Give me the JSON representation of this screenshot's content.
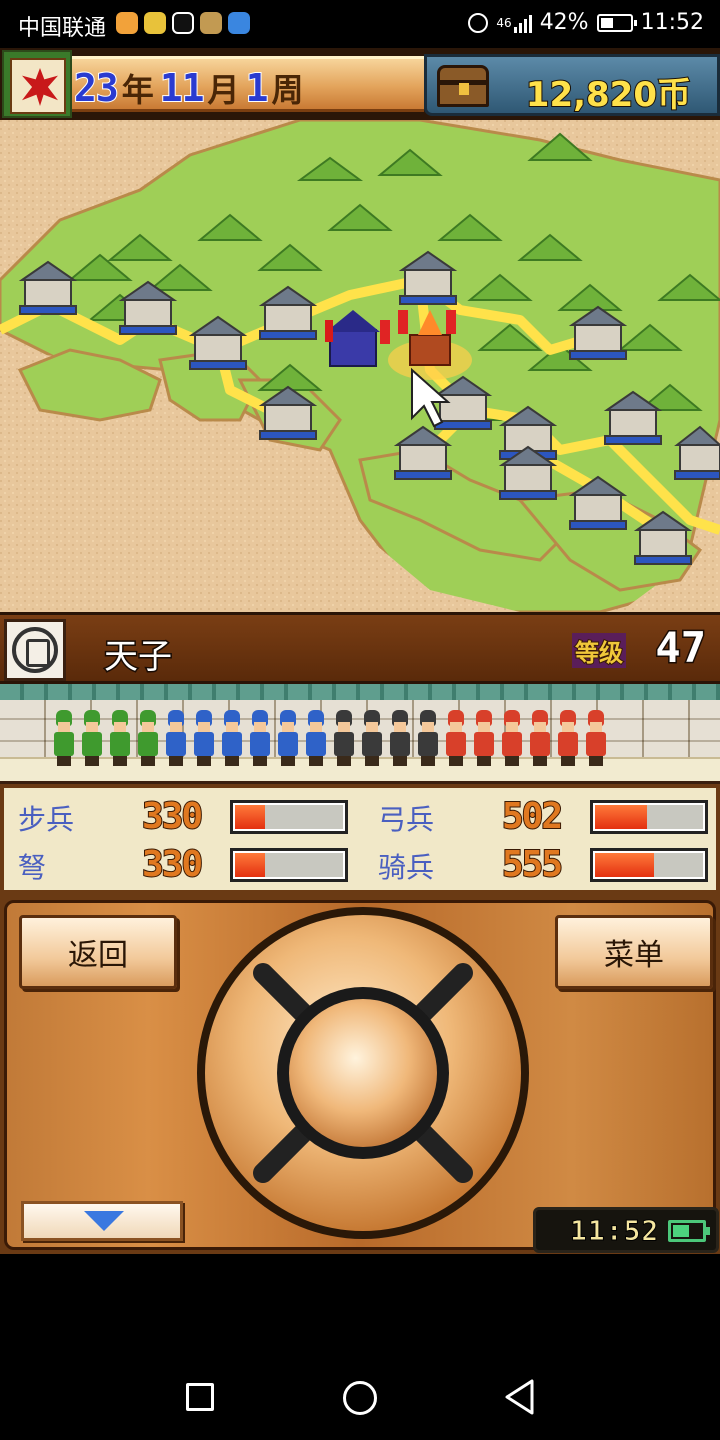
{
  "status_bar": {
    "carrier": "中国联通",
    "network": "46",
    "battery": "42%",
    "time": "11:52",
    "icons": [
      "notification-app-icon",
      "notification-app-icon",
      "tiktok-icon",
      "notification-app-icon",
      "shield-app-icon",
      "alarm-icon",
      "signal-icon",
      "battery-icon"
    ]
  },
  "header": {
    "year": "23",
    "year_unit": "年",
    "month": "11",
    "month_unit": "月",
    "week": "1",
    "week_unit": "周",
    "money": "12,820币"
  },
  "player": {
    "name": "天子",
    "level_label": "等级",
    "level": "47"
  },
  "army": {
    "soldiers": [
      {
        "type": "infantry",
        "color": "#3f9a2e"
      },
      {
        "type": "infantry",
        "color": "#3f9a2e"
      },
      {
        "type": "infantry",
        "color": "#3f9a2e"
      },
      {
        "type": "infantry",
        "color": "#3f9a2e"
      },
      {
        "type": "archer",
        "color": "#2f62c8"
      },
      {
        "type": "archer",
        "color": "#2f62c8"
      },
      {
        "type": "archer",
        "color": "#2f62c8"
      },
      {
        "type": "archer",
        "color": "#2f62c8"
      },
      {
        "type": "archer",
        "color": "#2f62c8"
      },
      {
        "type": "archer",
        "color": "#2f62c8"
      },
      {
        "type": "crossbow",
        "color": "#3a3a3a"
      },
      {
        "type": "crossbow",
        "color": "#3a3a3a"
      },
      {
        "type": "crossbow",
        "color": "#3a3a3a"
      },
      {
        "type": "crossbow",
        "color": "#3a3a3a"
      },
      {
        "type": "cavalry",
        "color": "#d8402a"
      },
      {
        "type": "cavalry",
        "color": "#d8402a"
      },
      {
        "type": "cavalry",
        "color": "#d8402a"
      },
      {
        "type": "cavalry",
        "color": "#d8402a"
      },
      {
        "type": "cavalry",
        "color": "#d8402a"
      },
      {
        "type": "cavalry",
        "color": "#d8402a"
      }
    ]
  },
  "stats": [
    {
      "label": "步兵",
      "value": "330",
      "fill": 0.3
    },
    {
      "label": "弓兵",
      "value": "502",
      "fill": 0.5
    },
    {
      "label": "弩",
      "value": "330",
      "fill": 0.3
    },
    {
      "label": "骑兵",
      "value": "555",
      "fill": 0.56
    }
  ],
  "controls": {
    "back_label": "返回",
    "menu_label": "菜单",
    "clock": "11:52"
  },
  "colors": {
    "sand": "#e6c59a",
    "grass": "#a6d65c",
    "road": "#ffe24a",
    "stat_label": "#4a5fc0",
    "wood": "#c17a38"
  }
}
